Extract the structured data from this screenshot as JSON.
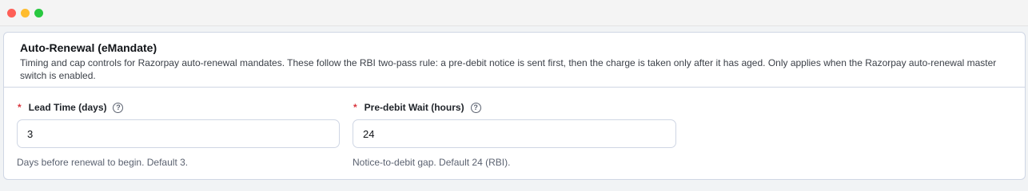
{
  "card": {
    "title": "Auto-Renewal (eMandate)",
    "description": "Timing and cap controls for Razorpay auto-renewal mandates. These follow the RBI two-pass rule: a pre-debit notice is sent first, then the charge is taken only after it has aged. Only applies when the Razorpay auto-renewal master switch is enabled."
  },
  "fields": {
    "lead_time": {
      "required_mark": "*",
      "label": "Lead Time (days)",
      "value": "3",
      "hint": "Days before renewal to begin. Default 3.",
      "help_icon": "question-circle-icon"
    },
    "pre_debit_wait": {
      "required_mark": "*",
      "label": "Pre-debit Wait (hours)",
      "value": "24",
      "hint": "Notice-to-debit gap. Default 24 (RBI).",
      "help_icon": "question-circle-icon"
    }
  },
  "colors": {
    "required": "#d9363e",
    "border": "#cfd6e4"
  }
}
